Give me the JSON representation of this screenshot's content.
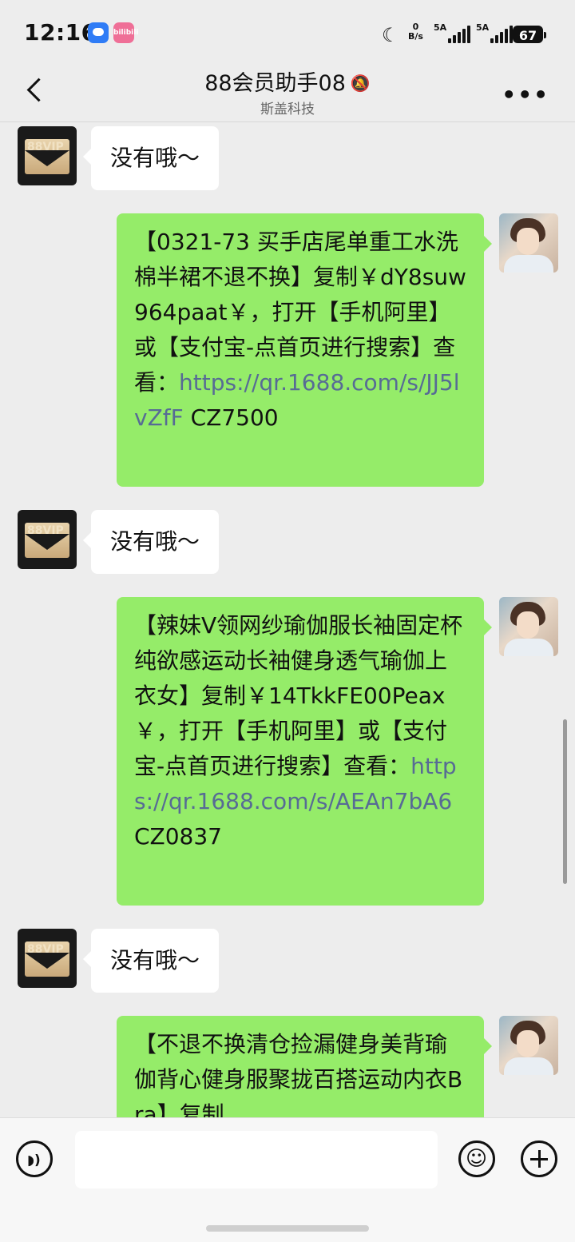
{
  "status_bar": {
    "time": "12:16",
    "app_icons": [
      "message-app-icon",
      "bilibili-icon"
    ],
    "bili_label": "bilibili",
    "net_speed_value": "0",
    "net_speed_unit": "B/s",
    "signal_1_label": "5A",
    "signal_2_label": "5A",
    "battery": "67"
  },
  "header": {
    "title": "88会员助手08",
    "subtitle": "斯盖科技",
    "mute_icon": "bell-slash-icon",
    "more_label": "•••"
  },
  "messages": [
    {
      "side": "left",
      "avatar_text": "88VIP",
      "text": "没有哦～"
    },
    {
      "side": "right",
      "text_before_link": "【0321-73 买手店尾单重工水洗棉半裙不退不换】复制￥dY8suw964paat￥，打开【手机阿里】或【支付宝-点首页进行搜索】查看：",
      "link": "https://qr.1688.com/s/JJ5lvZfF",
      "text_after_link": " CZ7500"
    },
    {
      "side": "left",
      "avatar_text": "88VIP",
      "text": "没有哦～"
    },
    {
      "side": "right",
      "text_before_link": "【辣妹V领网纱瑜伽服长袖固定杯纯欲感运动长袖健身透气瑜伽上衣女】复制￥14TkkFE00Peax￥，打开【手机阿里】或【支付宝-点首页进行搜索】查看：",
      "link": "https://qr.1688.com/s/AEAn7bA6",
      "text_after_link": " CZ0837"
    },
    {
      "side": "left",
      "avatar_text": "88VIP",
      "text": "没有哦～"
    },
    {
      "side": "right",
      "text_before_link": "【不退不换清仓捡漏健身美背瑜伽背心健身服聚拢百搭运动内衣Bra】复制",
      "link": "",
      "text_after_link": ""
    }
  ],
  "bottom_bar": {
    "voice_icon": "voice-icon",
    "emoji_icon": "emoji-icon",
    "plus_icon": "plus-icon",
    "input_value": ""
  },
  "colors": {
    "background": "#ededed",
    "bubble_self": "#95ec69",
    "bubble_other": "#ffffff",
    "link": "#576b95"
  }
}
